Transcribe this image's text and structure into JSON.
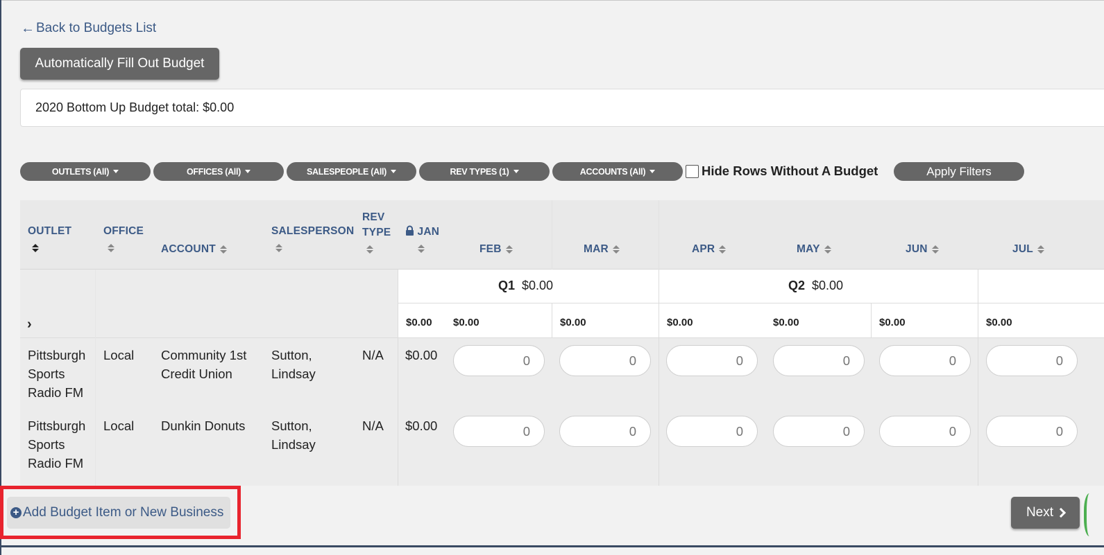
{
  "back_link": {
    "icon": "arrow-left-icon",
    "label": "Back to Budgets List"
  },
  "autofill_button": "Automatically Fill Out Budget",
  "budget_total": "2020 Bottom Up Budget total: $0.00",
  "filters": [
    {
      "label": "OUTLETS (All)"
    },
    {
      "label": "OFFICES (All)"
    },
    {
      "label": "SALESPEOPLE (All)"
    },
    {
      "label": "REV TYPES (1)"
    },
    {
      "label": "ACCOUNTS (All)"
    }
  ],
  "hide_rows_label": "Hide Rows Without A Budget",
  "hide_rows_checked": false,
  "apply_filters": "Apply Filters",
  "table": {
    "columns": {
      "outlet": "OUTLET",
      "office": "OFFICE",
      "account": "ACCOUNT",
      "salesperson": "SALESPERSON",
      "rev_type_line1": "REV",
      "rev_type_line2": "TYPE",
      "jan": "JAN",
      "feb": "FEB",
      "mar": "MAR",
      "apr": "APR",
      "may": "MAY",
      "jun": "JUN",
      "jul": "JUL"
    },
    "quarters": [
      {
        "label": "Q1",
        "value": "$0.00"
      },
      {
        "label": "Q2",
        "value": "$0.00"
      }
    ],
    "month_totals": [
      "$0.00",
      "$0.00",
      "$0.00",
      "$0.00",
      "$0.00",
      "$0.00",
      "$0.00"
    ],
    "rows": [
      {
        "outlet": [
          "Pittsburgh",
          "Sports",
          "Radio FM"
        ],
        "office": "Local",
        "account": [
          "Community 1st",
          "Credit Union"
        ],
        "salesperson": [
          "Sutton,",
          "Lindsay"
        ],
        "rev_type": "N/A",
        "jan": "$0.00",
        "inputs": [
          "0",
          "0",
          "0",
          "0",
          "0",
          "0"
        ]
      },
      {
        "outlet": [
          "Pittsburgh",
          "Sports",
          "Radio FM"
        ],
        "office": "Local",
        "account": [
          "Dunkin Donuts"
        ],
        "salesperson": [
          "Sutton,",
          "Lindsay"
        ],
        "rev_type": "N/A",
        "jan": "$0.00",
        "inputs": [
          "0",
          "0",
          "0",
          "0",
          "0",
          "0"
        ]
      }
    ]
  },
  "add_button": "Add Budget Item or New Business",
  "next_button": "Next"
}
